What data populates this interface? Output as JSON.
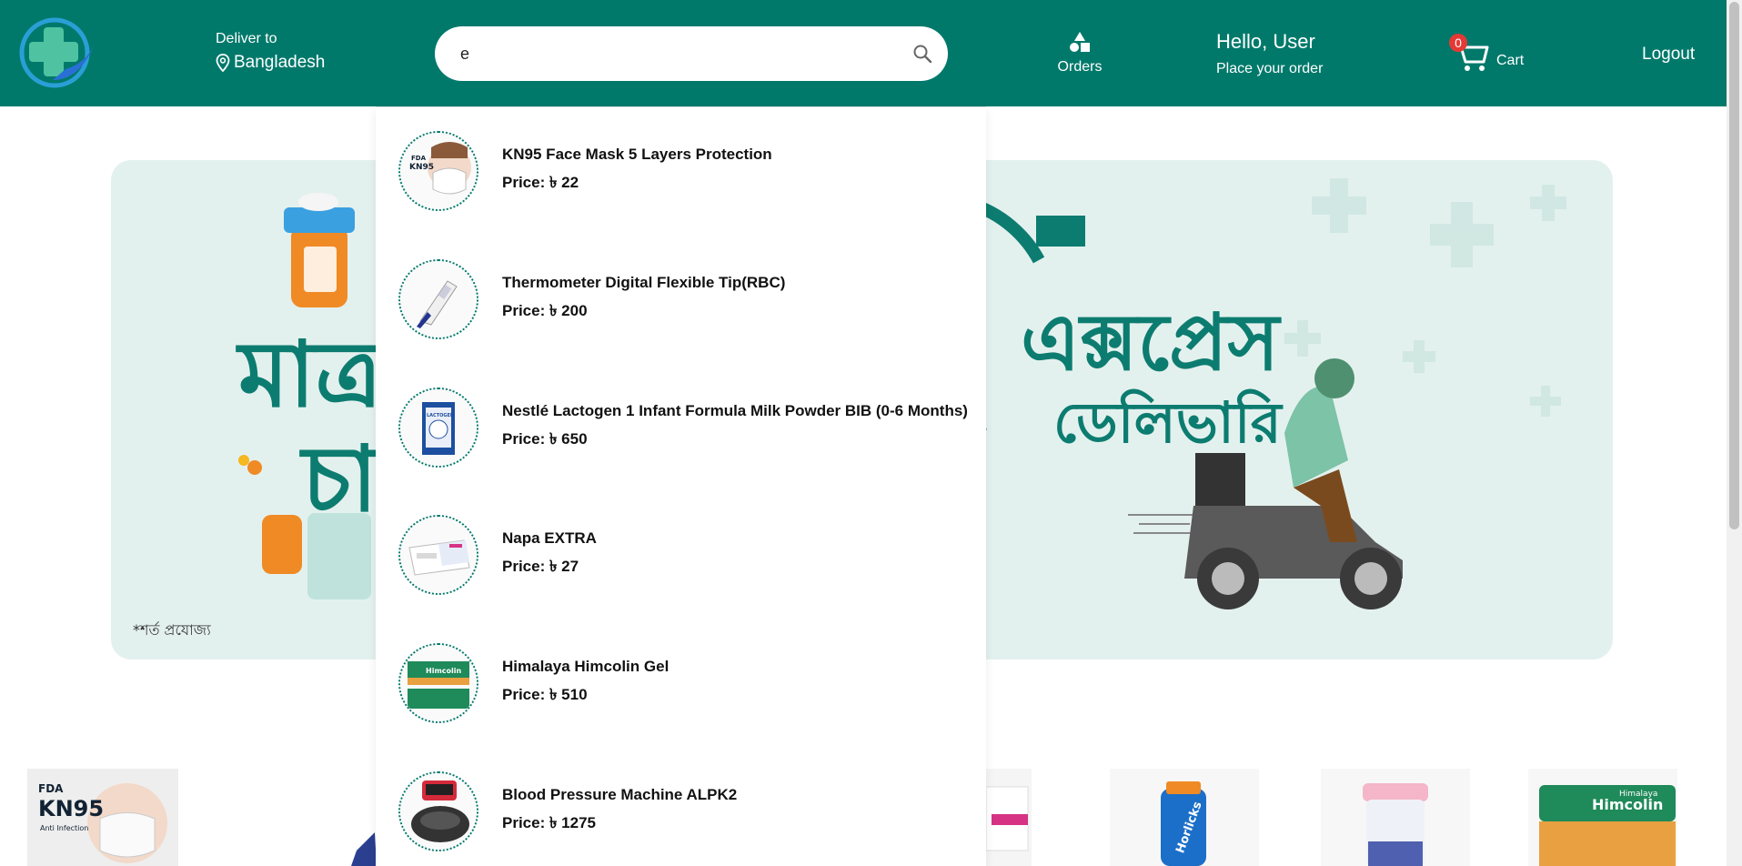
{
  "header": {
    "deliver_label": "Deliver to",
    "location": "Bangladesh",
    "search_value": "e",
    "orders_label": "Orders",
    "greeting": "Hello, User",
    "greeting_sub": "Place your order",
    "cart_count": "0",
    "cart_label": "Cart",
    "logout_label": "Logout"
  },
  "banner": {
    "text_left_1": "মাত্র",
    "text_left_2": "চা",
    "footnote": "*শর্ত প্রযোজ্য",
    "text_right_1": "এক্সপ্রেস",
    "text_right_2": "ডেলিভারি"
  },
  "results": [
    {
      "name": "KN95 Face Mask 5 Layers Protection",
      "price": "Price: ৳ 22",
      "icon": "face-mask"
    },
    {
      "name": "Thermometer Digital Flexible Tip(RBC)",
      "price": "Price: ৳ 200",
      "icon": "thermometer"
    },
    {
      "name": "Nestlé Lactogen 1 Infant Formula Milk Powder BIB (0-6 Months)",
      "price": "Price: ৳ 650",
      "icon": "formula-box"
    },
    {
      "name": "Napa EXTRA",
      "price": "Price: ৳ 27",
      "icon": "tablet-box"
    },
    {
      "name": "Himalaya Himcolin Gel",
      "price": "Price: ৳ 510",
      "icon": "gel-box"
    },
    {
      "name": "Blood Pressure Machine ALPK2",
      "price": "Price: ৳ 1275",
      "icon": "bp-machine"
    }
  ],
  "thumb_labels": {
    "mask_brand": "KN95",
    "mask_fda": "FDA",
    "mask_sub": "Anti Infection",
    "himcolin": "Himcolin",
    "himcolin_sub": "Himalaya",
    "lactogen": "LACTOGEN",
    "horlicks": "Horlicks"
  },
  "colors": {
    "brand": "#00796b",
    "badge": "#e53935"
  }
}
